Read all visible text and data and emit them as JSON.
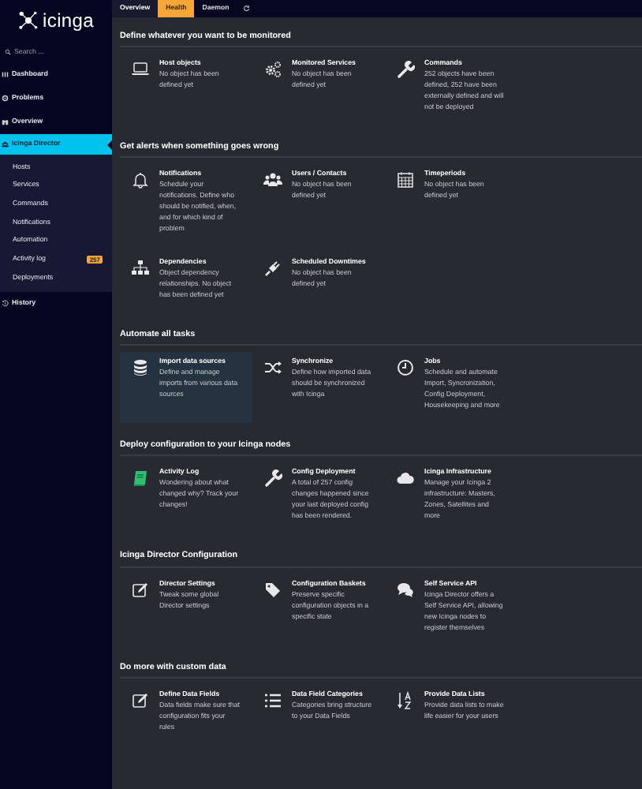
{
  "sidebar": {
    "logo": "icinga",
    "search": {
      "placeholder": "Search ..."
    },
    "items": [
      {
        "label": "Dashboard",
        "selected": false
      },
      {
        "label": "Problems",
        "selected": false
      },
      {
        "label": "Overview",
        "selected": false
      },
      {
        "label": "Icinga Director",
        "selected": true,
        "expanded": true,
        "children": [
          {
            "label": "Hosts",
            "selected": false
          },
          {
            "label": "Services",
            "selected": false
          },
          {
            "label": "Commands",
            "selected": false
          },
          {
            "label": "Notifications",
            "selected": false
          },
          {
            "label": "Automation",
            "selected": false
          },
          {
            "label": "Activity log",
            "selected": false,
            "badge": "257"
          },
          {
            "label": "Deployments",
            "selected": false
          }
        ]
      },
      {
        "label": "History",
        "selected": false
      }
    ]
  },
  "tabs": [
    {
      "label": "Overview",
      "selected": true,
      "warning": false
    },
    {
      "label": "Health",
      "selected": false,
      "warning": true
    },
    {
      "label": "Daemon",
      "selected": false,
      "warning": false
    }
  ],
  "sections": [
    {
      "title": "Define whatever you want to be monitored",
      "tiles": [
        {
          "title": "Host objects",
          "text": "No object has been defined yet",
          "highlighted": false
        },
        {
          "title": "Monitored Services",
          "text": "No object has been defined yet",
          "highlighted": false
        },
        {
          "title": "Commands",
          "text": "252 objects have been defined, 252 have been externally defined and will not be deployed",
          "highlighted": false
        }
      ]
    },
    {
      "title": "Get alerts when something goes wrong",
      "tiles": [
        {
          "title": "Notifications",
          "text": "Schedule your notifications. Define who should be notified, when, and for which kind of problem",
          "highlighted": false
        },
        {
          "title": "Users / Contacts",
          "text": "No object has been defined yet",
          "highlighted": false
        },
        {
          "title": "Timeperiods",
          "text": "No object has been defined yet",
          "highlighted": false
        },
        {
          "title": "Dependencies",
          "text": "Object dependency relationships. No object has been defined yet",
          "highlighted": false
        },
        {
          "title": "Scheduled Downtimes",
          "text": "No object has been defined yet",
          "highlighted": false
        }
      ]
    },
    {
      "title": "Automate all tasks",
      "tiles": [
        {
          "title": "Import data sources",
          "text": "Define and manage imports from various data sources",
          "highlighted": true
        },
        {
          "title": "Synchronize",
          "text": "Define how imported data should be synchronized with Icinga",
          "highlighted": false
        },
        {
          "title": "Jobs",
          "text": "Schedule and automate Import, Syncronization, Config Deployment, Housekeeping and more",
          "highlighted": false
        }
      ]
    },
    {
      "title": "Deploy configuration to your Icinga nodes",
      "tiles": [
        {
          "title": "Activity Log",
          "text": "Wondering about what changed why? Track your changes!",
          "highlighted": false
        },
        {
          "title": "Config Deployment",
          "text": "A total of 257 config changes happened since your last deployed config has been rendered.",
          "highlighted": false
        },
        {
          "title": "Icinga Infrastructure",
          "text": "Manage your Icinga 2 infrastructure: Masters, Zones, Satellites and more",
          "highlighted": false
        }
      ]
    },
    {
      "title": "Icinga Director Configuration",
      "tiles": [
        {
          "title": "Director Settings",
          "text": "Tweak some global Director settings",
          "highlighted": false
        },
        {
          "title": "Configuration Baskets",
          "text": "Preserve specific configuration objects in a specific state",
          "highlighted": false
        },
        {
          "title": "Self Service API",
          "text": "Icinga Director offers a Self Service API, allowing new Icinga nodes to register themselves",
          "highlighted": false
        }
      ]
    },
    {
      "title": "Do more with custom data",
      "tiles": [
        {
          "title": "Define Data Fields",
          "text": "Data fields make sure that configuration fits your rules",
          "highlighted": false
        },
        {
          "title": "Data Field Categories",
          "text": "Categories bring structure to your Data Fields",
          "highlighted": false
        },
        {
          "title": "Provide Data Lists",
          "text": "Provide data lists to make life easier for your users",
          "highlighted": false
        }
      ]
    }
  ]
}
